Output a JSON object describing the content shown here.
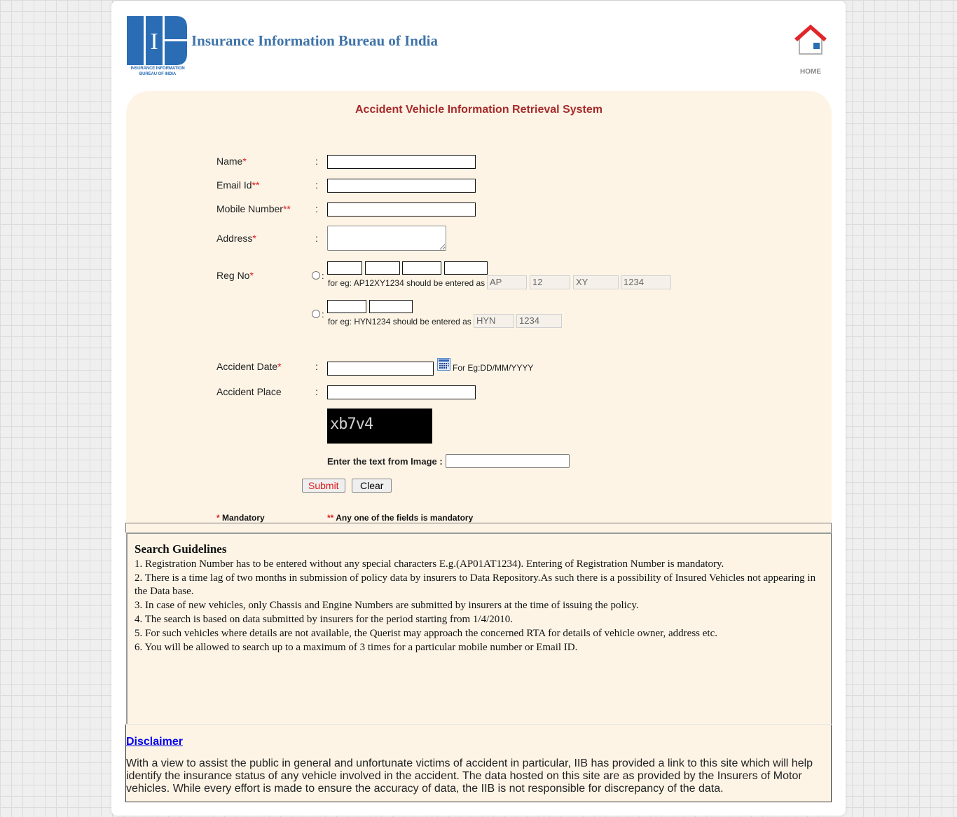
{
  "header": {
    "brand_title": "Insurance Information Bureau of India",
    "logo_letter": "I",
    "logo_caption_line1": "INSURANCE INFORMATION",
    "logo_caption_line2": "BUREAU OF INDIA",
    "home_label": "HOME",
    "colors": {
      "brand": "#3f73a8",
      "logo_blue": "#2a6db5",
      "home_roof": "#e0262b"
    }
  },
  "form": {
    "title": "Accident Vehicle Information Retrieval System",
    "colon": ":",
    "fields": {
      "name": {
        "label": "Name",
        "marker": "*",
        "value": ""
      },
      "email": {
        "label": "Email Id",
        "marker": "**",
        "value": ""
      },
      "mobile": {
        "label": "Mobile Number",
        "marker": "**",
        "value": ""
      },
      "address": {
        "label": "Address",
        "marker": "*",
        "value": ""
      },
      "reg_no": {
        "label": "Reg No",
        "marker": "*",
        "option1": {
          "hint": "for eg: AP12XY1234 should be entered as",
          "samples": [
            "AP",
            "12",
            "XY",
            "1234"
          ],
          "values": [
            "",
            "",
            "",
            ""
          ]
        },
        "option2": {
          "hint": "for eg: HYN1234 should be entered as",
          "samples": [
            "HYN",
            "1234"
          ],
          "values": [
            "",
            ""
          ]
        }
      },
      "accident_date": {
        "label": "Accident Date",
        "marker": "*",
        "value": "",
        "hint": "For Eg:DD/MM/YYYY"
      },
      "accident_place": {
        "label": "Accident Place",
        "value": ""
      }
    },
    "captcha": {
      "image_text": "xb7v4",
      "label": "Enter the text from Image :",
      "value": ""
    },
    "buttons": {
      "submit": "Submit",
      "clear": "Clear"
    },
    "legend": {
      "single_marker": "*",
      "single_text": "Mandatory",
      "double_marker": "**",
      "double_text": "Any one of the fields is mandatory"
    },
    "colors": {
      "title": "#a62a2a",
      "required": "#e01a1a",
      "panel_bg": "#fdf4e6"
    }
  },
  "guidelines": {
    "title": "Search Guidelines",
    "items": [
      "1. Registration Number has to be entered without any special characters E.g.(AP01AT1234). Entering of Registration Number is mandatory.",
      "2. There is a time lag of two months in submission of policy data by insurers to Data Repository.As such there is a possibility of Insured Vehicles not appearing in the Data base.",
      "3. In case of new vehicles, only Chassis and Engine Numbers are submitted by insurers at the time of issuing the policy.",
      "4. The search is based on data submitted by insurers for the period starting from 1/4/2010.",
      "5. For such vehicles where details are not available, the Querist may approach the concerned RTA for details of vehicle owner, address etc.",
      "6. You will be allowed to search up to a maximum of 3 times for a particular mobile number or Email ID."
    ]
  },
  "disclaimer": {
    "link_label": "Disclaimer",
    "text": "With a view to assist the public in general and unfortunate victims of accident in particular, IIB has provided a link to this site which will help identify the insurance status of any vehicle involved in the accident. The data hosted on this site are as provided by the Insurers of Motor vehicles. While every effort is made to ensure the accuracy of data, the IIB is not responsible for discrepancy of the data."
  }
}
